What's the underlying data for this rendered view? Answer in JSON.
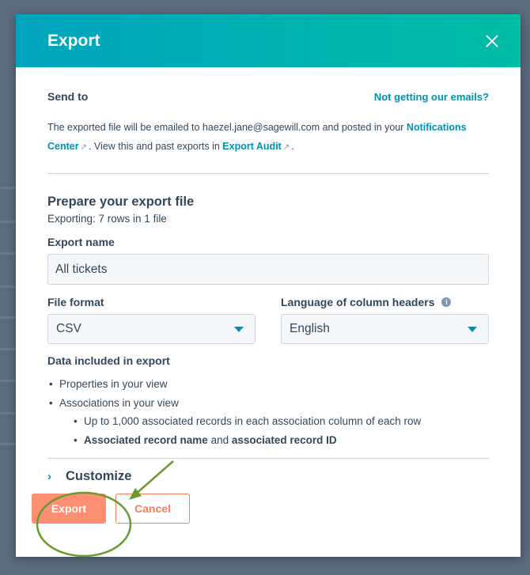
{
  "modal": {
    "title": "Export"
  },
  "send_to": {
    "heading": "Send to",
    "help_link": "Not getting our emails?",
    "desc_prefix": "The exported file will be emailed to haezel.jane@sagewill.com and posted in your ",
    "notifications_link": "Notifications Center",
    "desc_middle": ". View this and past exports in ",
    "audit_link": "Export Audit",
    "desc_suffix": "."
  },
  "prepare": {
    "heading": "Prepare your export file",
    "exporting": "Exporting:  7 rows in 1 file"
  },
  "export_name": {
    "label": "Export name",
    "value": "All tickets"
  },
  "file_format": {
    "label": "File format",
    "value": "CSV"
  },
  "language": {
    "label": "Language of column headers",
    "value": "English"
  },
  "data_included": {
    "heading": "Data included in export",
    "items": [
      "Properties in your view",
      "Associations in your view"
    ],
    "sub_items": {
      "first": "Up to 1,000 associated records in each association column of each row",
      "second_bold_a": "Associated record name",
      "second_mid": " and ",
      "second_bold_b": "associated record ID"
    }
  },
  "customize": {
    "label": "Customize"
  },
  "buttons": {
    "export": "Export",
    "cancel": "Cancel"
  },
  "colors": {
    "header_start": "#00a4bd",
    "header_end": "#00bda5",
    "link": "#0091ae",
    "primary": "#ff8f73",
    "annotation": "#6a9a2c"
  }
}
